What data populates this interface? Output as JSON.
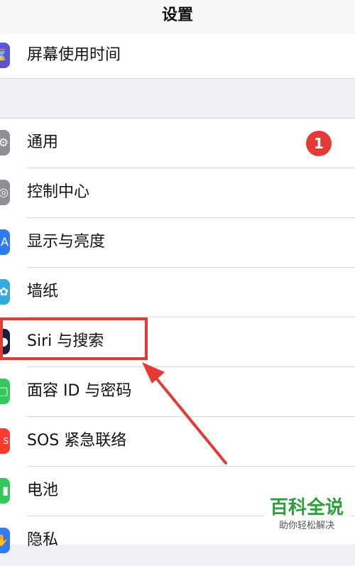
{
  "nav": {
    "title": "设置"
  },
  "top_group": {
    "items": [
      {
        "label": "屏幕使用时间",
        "icon": "hourglass-icon",
        "color": "#5856d6"
      }
    ]
  },
  "main_group": {
    "items": [
      {
        "label": "通用",
        "icon": "gear-icon",
        "color": "#8e8e93",
        "badge": "1"
      },
      {
        "label": "控制中心",
        "icon": "toggles-icon",
        "color": "#8e8e93"
      },
      {
        "label": "显示与亮度",
        "icon": "brightness-icon",
        "color": "#2d7cf6"
      },
      {
        "label": "墙纸",
        "icon": "flower-icon",
        "color": "#34aadc"
      },
      {
        "label": "Siri 与搜索",
        "icon": "siri-icon",
        "color": "#1c1c3a"
      },
      {
        "label": "面容 ID 与密码",
        "icon": "face-id-icon",
        "color": "#34c759"
      },
      {
        "label": "SOS 紧急联络",
        "icon": "sos-icon",
        "color": "#ff3b30"
      },
      {
        "label": "电池",
        "icon": "battery-icon",
        "color": "#34c759"
      },
      {
        "label": "隐私",
        "icon": "hand-icon",
        "color": "#2d7cf6"
      }
    ]
  },
  "watermark": {
    "logo": "百科全说",
    "subtitle": "助你轻松解决"
  },
  "colors": {
    "highlight": "#e53935",
    "badge": "#e53935"
  }
}
